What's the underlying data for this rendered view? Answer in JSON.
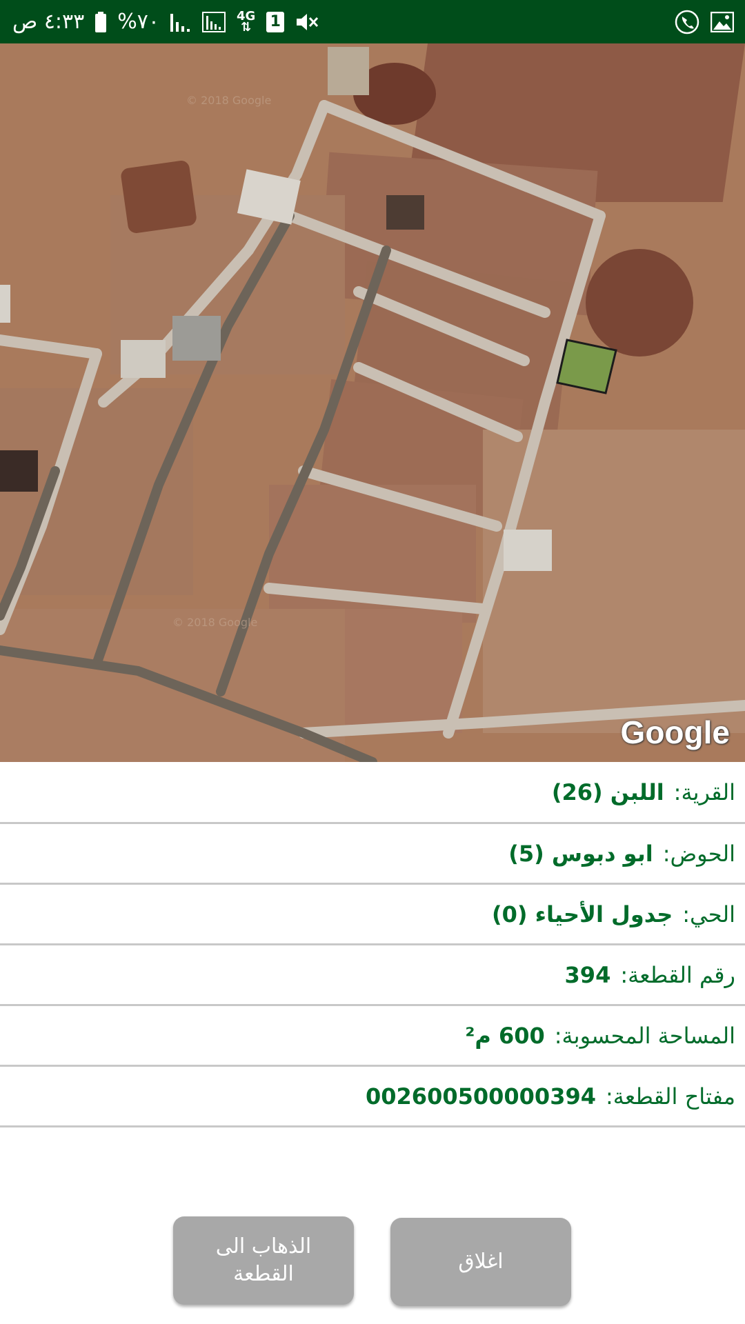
{
  "status_bar": {
    "time": "٤:٣٣ ص",
    "battery": "%٧٠",
    "network": "4G",
    "sim": "1",
    "icons": [
      "battery-icon",
      "signal-icon",
      "signal-icon",
      "mute-icon",
      "call-icon",
      "image-icon"
    ]
  },
  "map": {
    "attribution": "Google",
    "watermark": "© 2018 Google",
    "colors": {
      "terrain": "#a97a5c",
      "road": "#c9bfb3",
      "parcel_fill": "#7a9a4a"
    }
  },
  "parcel": {
    "rows": [
      {
        "label": "القرية:",
        "value": "اللبن (26)"
      },
      {
        "label": "الحوض:",
        "value": "ابو دبوس (5)"
      },
      {
        "label": "الحي:",
        "value": "جدول الأحياء (0)"
      },
      {
        "label": "رقم القطعة:",
        "value": "394"
      },
      {
        "label": "المساحة المحسوبة:",
        "value": "600 م²"
      },
      {
        "label": "مفتاح القطعة:",
        "value": "002600500000394"
      }
    ]
  },
  "buttons": {
    "goto_label": "الذهاب الى القطعة",
    "close_label": "اغلاق"
  },
  "theme": {
    "primary": "#006b2a",
    "status_bar": "#004d1a",
    "button_bg": "#a8a8a8"
  }
}
